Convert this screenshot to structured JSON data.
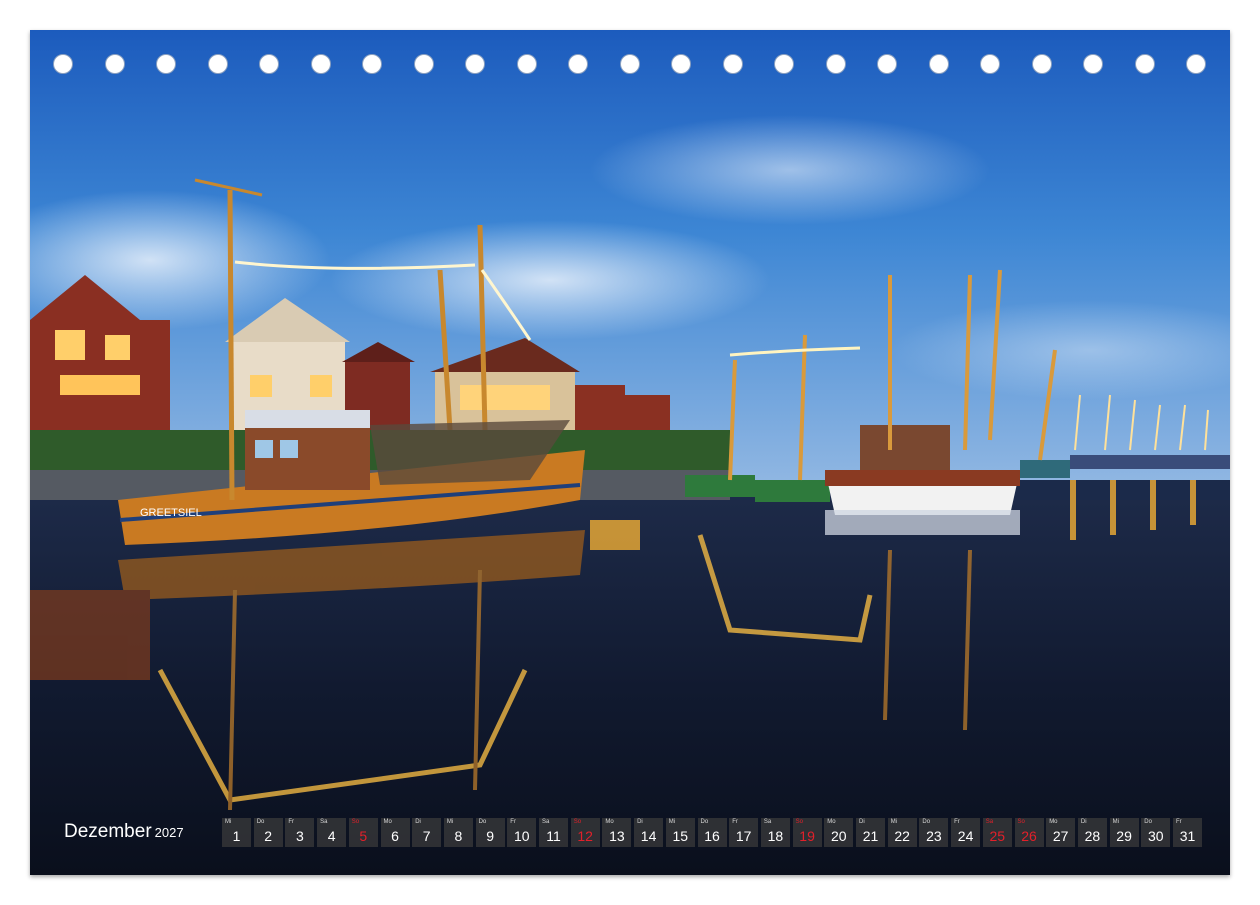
{
  "calendar": {
    "month": "Dezember",
    "year": "2027",
    "days": [
      {
        "wd": "Mi",
        "num": "1",
        "red": false
      },
      {
        "wd": "Do",
        "num": "2",
        "red": false
      },
      {
        "wd": "Fr",
        "num": "3",
        "red": false
      },
      {
        "wd": "Sa",
        "num": "4",
        "red": false
      },
      {
        "wd": "So",
        "num": "5",
        "red": true
      },
      {
        "wd": "Mo",
        "num": "6",
        "red": false
      },
      {
        "wd": "Di",
        "num": "7",
        "red": false
      },
      {
        "wd": "Mi",
        "num": "8",
        "red": false
      },
      {
        "wd": "Do",
        "num": "9",
        "red": false
      },
      {
        "wd": "Fr",
        "num": "10",
        "red": false
      },
      {
        "wd": "Sa",
        "num": "11",
        "red": false
      },
      {
        "wd": "So",
        "num": "12",
        "red": true
      },
      {
        "wd": "Mo",
        "num": "13",
        "red": false
      },
      {
        "wd": "Di",
        "num": "14",
        "red": false
      },
      {
        "wd": "Mi",
        "num": "15",
        "red": false
      },
      {
        "wd": "Do",
        "num": "16",
        "red": false
      },
      {
        "wd": "Fr",
        "num": "17",
        "red": false
      },
      {
        "wd": "Sa",
        "num": "18",
        "red": false
      },
      {
        "wd": "So",
        "num": "19",
        "red": true
      },
      {
        "wd": "Mo",
        "num": "20",
        "red": false
      },
      {
        "wd": "Di",
        "num": "21",
        "red": false
      },
      {
        "wd": "Mi",
        "num": "22",
        "red": false
      },
      {
        "wd": "Do",
        "num": "23",
        "red": false
      },
      {
        "wd": "Fr",
        "num": "24",
        "red": false
      },
      {
        "wd": "Sa",
        "num": "25",
        "red": true
      },
      {
        "wd": "So",
        "num": "26",
        "red": true
      },
      {
        "wd": "Mo",
        "num": "27",
        "red": false
      },
      {
        "wd": "Di",
        "num": "28",
        "red": false
      },
      {
        "wd": "Mi",
        "num": "29",
        "red": false
      },
      {
        "wd": "Do",
        "num": "30",
        "red": false
      },
      {
        "wd": "Fr",
        "num": "31",
        "red": false
      }
    ]
  },
  "photo": {
    "boat_name": "GREETSIEL",
    "colors": {
      "sky_top": "#1f62c4",
      "sky_mid": "#3f86d6",
      "water": "#0d1526",
      "hull_orange": "#c97a22",
      "lights": "#ffb733"
    }
  },
  "binding_hole_count": 23
}
